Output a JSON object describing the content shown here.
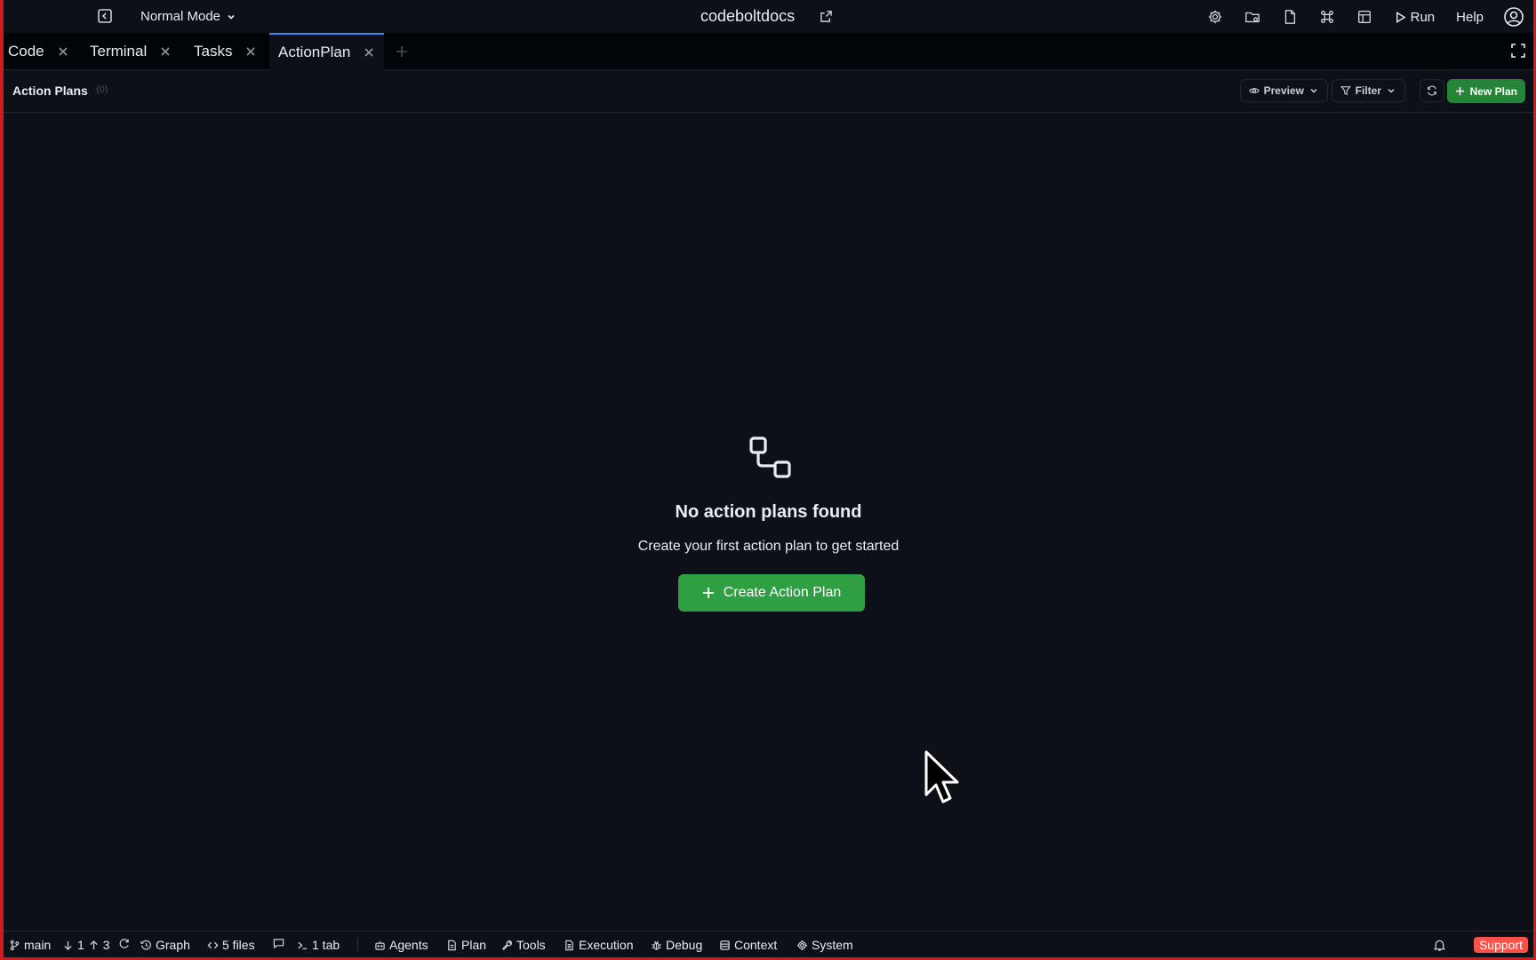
{
  "titlebar": {
    "mode": "Normal Mode",
    "title": "codeboltdocs",
    "run_label": "Run",
    "help_label": "Help"
  },
  "tabs": [
    {
      "label": "Code"
    },
    {
      "label": "Terminal"
    },
    {
      "label": "Tasks"
    },
    {
      "label": "ActionPlan",
      "active": true
    }
  ],
  "toolbar": {
    "title": "Action Plans",
    "count": "(0)",
    "preview_label": "Preview",
    "filter_label": "Filter",
    "new_plan_label": "New Plan"
  },
  "empty_state": {
    "title": "No action plans found",
    "subtitle": "Create your first action plan to get started",
    "button_label": "Create Action Plan"
  },
  "statusbar": {
    "branch": "main",
    "behind": "1",
    "ahead": "3",
    "graph": "Graph",
    "files": "5 files",
    "tabs": "1 tab",
    "agents": "Agents",
    "plan": "Plan",
    "tools": "Tools",
    "execution": "Execution",
    "debug": "Debug",
    "context": "Context",
    "system": "System",
    "support": "Support"
  },
  "colors": {
    "background": "#0d1117",
    "accent_green": "#2ea043",
    "active_tab_border": "#388bfd",
    "support_red": "#f85149",
    "frame_red": "#d11a1a"
  }
}
